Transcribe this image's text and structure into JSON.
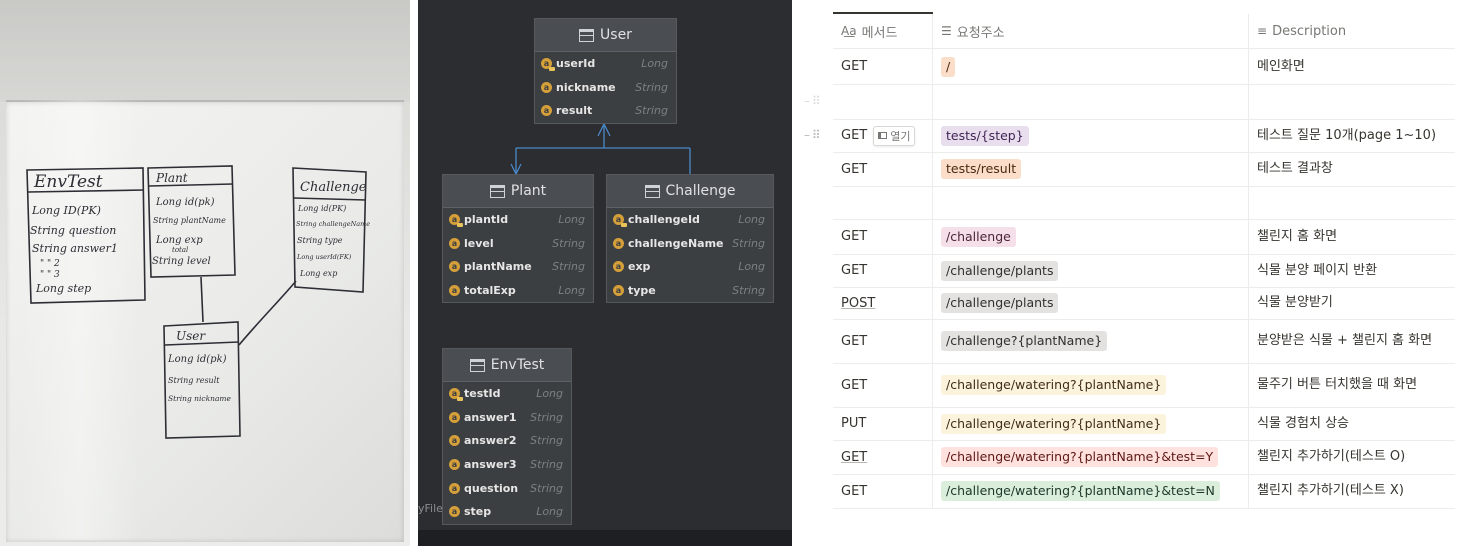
{
  "whiteboard": {
    "envtest": {
      "title": "EnvTest",
      "lines": [
        "Long ID(PK)",
        "String question",
        "String answer1",
        "\"   \"  2",
        "\"   \"  3",
        "Long step"
      ]
    },
    "plant": {
      "title": "Plant",
      "lines": [
        "Long id(pk)",
        "String plantName",
        "Long exp",
        "total",
        "String level"
      ]
    },
    "challenge": {
      "title": "Challenge",
      "lines": [
        "Long id(PK)",
        "String challengeName",
        "String type",
        "Long userId(FK)",
        "Long exp"
      ]
    },
    "user": {
      "title": "User",
      "lines": [
        "Long id(pk)",
        "String result",
        "String nickname"
      ]
    }
  },
  "erd": {
    "user": {
      "title": "User",
      "fields": [
        {
          "name": "userId",
          "type": "Long",
          "pk": true
        },
        {
          "name": "nickname",
          "type": "String",
          "pk": false
        },
        {
          "name": "result",
          "type": "String",
          "pk": false
        }
      ]
    },
    "plant": {
      "title": "Plant",
      "fields": [
        {
          "name": "plantId",
          "type": "Long",
          "pk": true
        },
        {
          "name": "level",
          "type": "String",
          "pk": false
        },
        {
          "name": "plantName",
          "type": "String",
          "pk": false
        },
        {
          "name": "totalExp",
          "type": "Long",
          "pk": false
        }
      ]
    },
    "challenge": {
      "title": "Challenge",
      "fields": [
        {
          "name": "challengeId",
          "type": "Long",
          "pk": true
        },
        {
          "name": "challengeName",
          "type": "String",
          "pk": false
        },
        {
          "name": "exp",
          "type": "Long",
          "pk": false
        },
        {
          "name": "type",
          "type": "String",
          "pk": false
        }
      ]
    },
    "envtest": {
      "title": "EnvTest",
      "fields": [
        {
          "name": "testId",
          "type": "Long",
          "pk": true
        },
        {
          "name": "answer1",
          "type": "String",
          "pk": false
        },
        {
          "name": "answer2",
          "type": "String",
          "pk": false
        },
        {
          "name": "answer3",
          "type": "String",
          "pk": false
        },
        {
          "name": "question",
          "type": "String",
          "pk": false
        },
        {
          "name": "step",
          "type": "Long",
          "pk": false
        }
      ]
    },
    "footer_fragment": "yFile"
  },
  "table": {
    "headers": {
      "method": "메서드",
      "url": "요청주소",
      "description": "Description"
    },
    "open_label": "열기",
    "rows": [
      {
        "method": "GET",
        "url": "/",
        "tag_color": "orange",
        "desc": "메인화면"
      },
      {
        "method": "",
        "url": "",
        "tag_color": "",
        "desc": ""
      },
      {
        "method": "GET",
        "url": "tests/{step}",
        "tag_color": "purple",
        "desc": "테스트 질문 10개(page 1~10)"
      },
      {
        "method": "GET",
        "url": "tests/result",
        "tag_color": "orange",
        "desc": "테스트 결과창"
      },
      {
        "method": "",
        "url": "",
        "tag_color": "",
        "desc": ""
      },
      {
        "method": "GET",
        "url": "/challenge",
        "tag_color": "pink",
        "desc": "챌린지 홈 화면"
      },
      {
        "method": "GET",
        "url": "/challenge/plants",
        "tag_color": "gray",
        "desc": "식물 분양 페이지 반환"
      },
      {
        "method": "POST",
        "url": "/challenge/plants",
        "tag_color": "gray",
        "desc": "식물 분양받기"
      },
      {
        "method": "GET",
        "url": "/challenge?{plantName}",
        "tag_color": "gray",
        "desc": "분양받은 식물 + 챌린지 홈 화면"
      },
      {
        "method": "GET",
        "url": "/challenge/watering?{plantName}",
        "tag_color": "yellow",
        "desc": "물주기 버튼 터치했을 때 화면"
      },
      {
        "method": "PUT",
        "url": "/challenge/watering?{plantName}",
        "tag_color": "yellow",
        "desc": "식물 경험치 상승"
      },
      {
        "method": "GET",
        "url": "/challenge/watering?{plantName}&test=Y",
        "tag_color": "red",
        "desc": "챌린지 추가하기(테스트 O)"
      },
      {
        "method": "GET",
        "url": "/challenge/watering?{plantName}&test=N",
        "tag_color": "green",
        "desc": "챌린지 추가하기(테스트 X)"
      }
    ]
  }
}
